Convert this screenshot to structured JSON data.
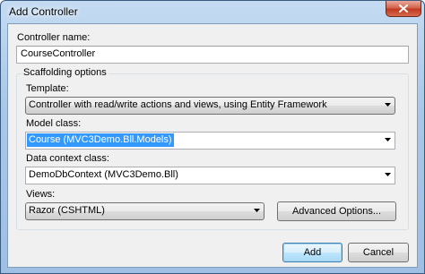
{
  "window": {
    "title": "Add Controller"
  },
  "controller_name": {
    "label": "Controller name:",
    "value": "CourseController"
  },
  "scaffolding": {
    "group_title": "Scaffolding options",
    "template": {
      "label": "Template:",
      "value": "Controller with read/write actions and views, using Entity Framework"
    },
    "model_class": {
      "label": "Model class:",
      "value": "Course (MVC3Demo.Bll.Models)"
    },
    "data_context": {
      "label": "Data context class:",
      "value": "DemoDbContext (MVC3Demo.Bll)"
    },
    "views": {
      "label": "Views:",
      "value": "Razor (CSHTML)"
    },
    "advanced_label": "Advanced Options..."
  },
  "buttons": {
    "add": "Add",
    "cancel": "Cancel"
  },
  "icons": {
    "close": "close-icon",
    "dropdown": "chevron-down-icon"
  }
}
